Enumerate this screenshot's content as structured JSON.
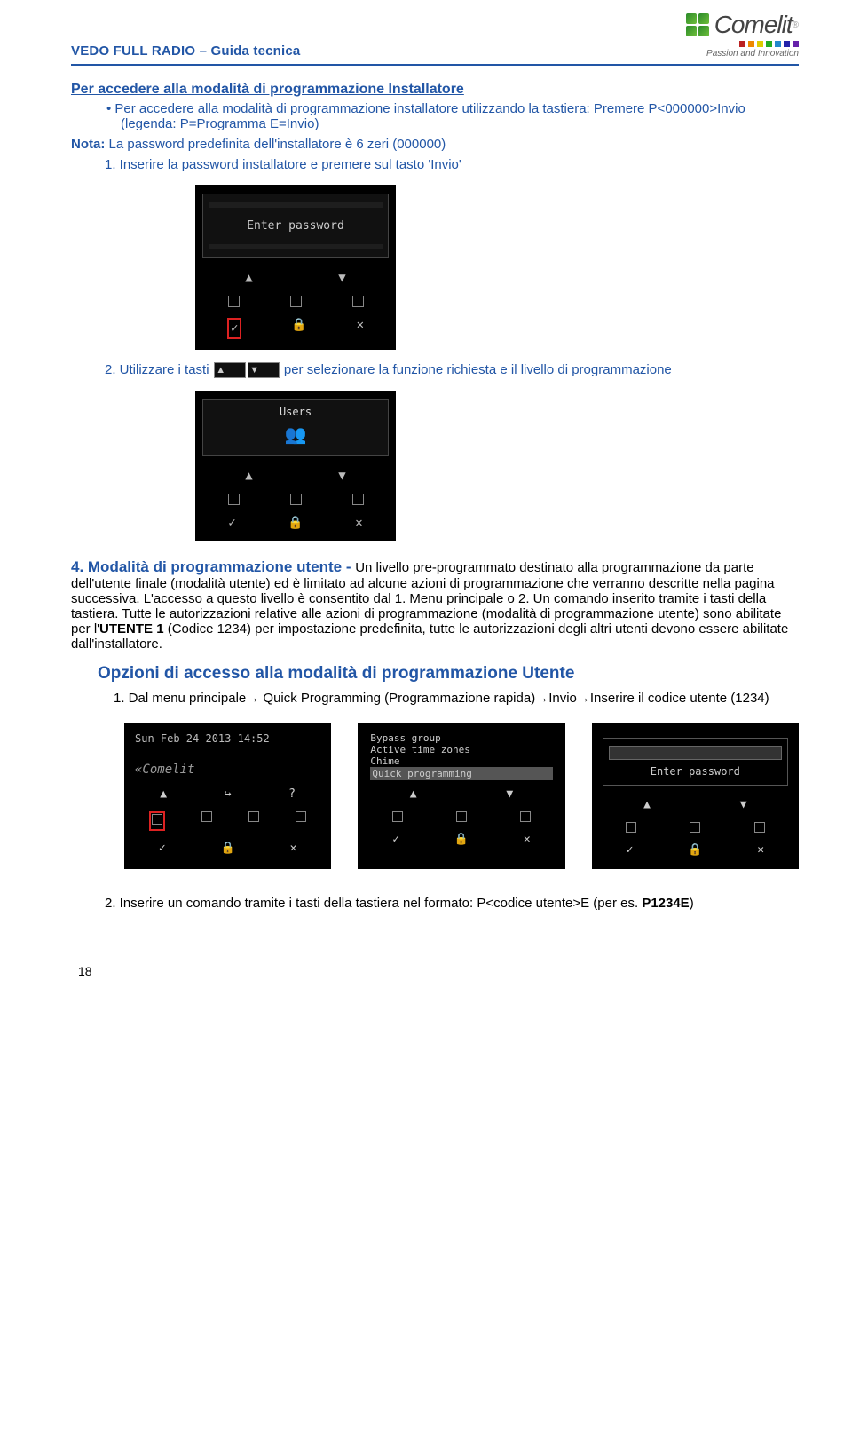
{
  "header": {
    "doc_title": "VEDO FULL RADIO – Guida tecnica",
    "brand": "Comelit",
    "tagline": "Passion and Innovation"
  },
  "section": {
    "title": "Per accedere alla modalità di programmazione Installatore",
    "bullet": "Per accedere alla modalità di programmazione installatore utilizzando la tastiera: Premere  P<000000>Invio (legenda: P=Programma    E=Invio)",
    "nota_label": "Nota:",
    "nota_text": "La password predefinita dell'installatore è 6 zeri (000000)",
    "step1": "1.  Inserire la password installatore e premere sul tasto 'Invio'"
  },
  "device1": {
    "screen_text": "Enter password"
  },
  "step2line": {
    "pre": "2.  Utilizzare i tasti ",
    "post": " per selezionare la funzione richiesta e il livello di programmazione"
  },
  "device2": {
    "screen_text": "Users"
  },
  "para4": {
    "lead": "4. Modalità di programmazione utente - ",
    "body": "Un livello pre-programmato destinato alla programmazione da parte dell'utente finale (modalità utente) ed è limitato ad alcune azioni di programmazione che verranno descritte nella pagina successiva. L'accesso a questo livello è consentito dal 1. Menu principale o 2. Un comando inserito tramite i tasti della tastiera. Tutte le autorizzazioni relative alle azioni di programmazione (modalità di programmazione utente) sono abilitate per l'",
    "utente": "UTENTE 1",
    "body2": " (Codice 1234) per impostazione predefinita, tutte le autorizzazioni degli altri utenti devono essere abilitate dall'installatore."
  },
  "opzioni": {
    "title": "Opzioni di accesso alla modalità di programmazione Utente",
    "step1a": "1. Dal menu principale→ Quick Programming (Programmazione rapida)→Invio→Inserire il codice utente (1234)"
  },
  "mini1": {
    "datetime": "Sun Feb 24 2013 14:52",
    "brand": "«Comelit"
  },
  "mini2": {
    "m1": "Bypass group",
    "m2": "Active time zones",
    "m3": "Chime",
    "m4": "Quick programming"
  },
  "mini3": {
    "screen_text": "Enter password"
  },
  "step_bottom": {
    "text": "2. Inserire un comando tramite i tasti della tastiera nel formato: P<codice utente>E (per es. ",
    "bold": "P1234E",
    "tail": ")"
  },
  "page_number": "18"
}
